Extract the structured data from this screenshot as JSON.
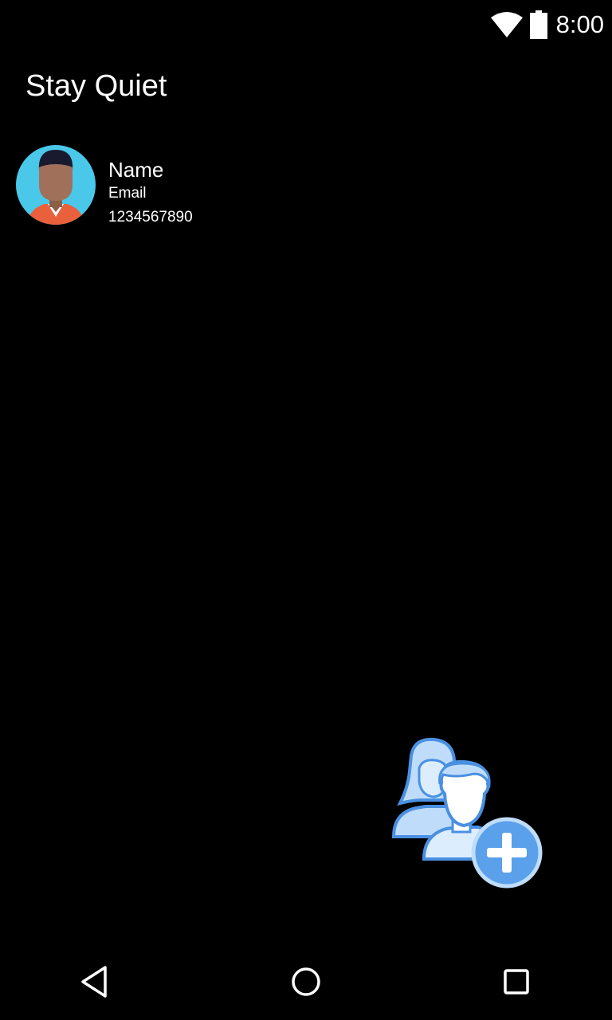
{
  "status_bar": {
    "time": "8:00",
    "icons": [
      "wifi-icon",
      "battery-icon"
    ]
  },
  "header": {
    "title": "Stay Quiet"
  },
  "contacts": [
    {
      "name": "Name",
      "email": "Email",
      "phone": "1234567890",
      "avatar": "person-avatar-icon"
    }
  ],
  "fab": {
    "icon": "add-contact-icon"
  },
  "nav_bar": {
    "icons": [
      "back-icon",
      "home-icon",
      "recents-icon"
    ]
  },
  "colors": {
    "background": "#000000",
    "text": "#ffffff",
    "avatar_bg": "#4AC8EA",
    "avatar_skin": "#A0705A",
    "avatar_shirt": "#E8603C",
    "fab_fill": "#BFDDFB",
    "fab_stroke": "#4A90E2"
  }
}
